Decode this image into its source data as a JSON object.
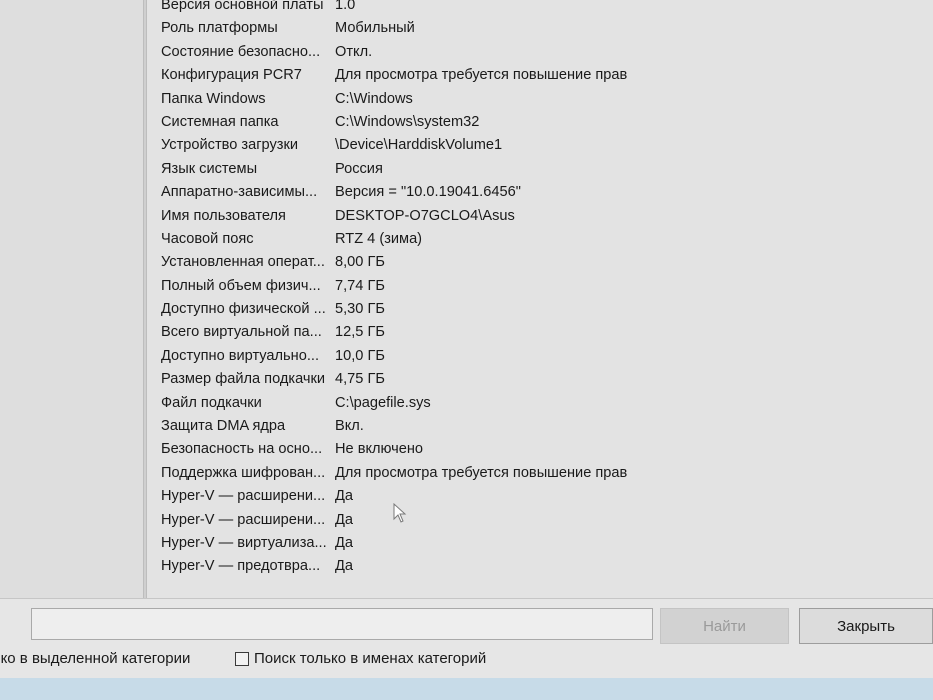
{
  "table": {
    "rows": [
      {
        "name": "Версия основной платы",
        "value": "1.0"
      },
      {
        "name": "Роль платформы",
        "value": "Мобильный"
      },
      {
        "name": "Состояние безопасно...",
        "value": "Откл."
      },
      {
        "name": "Конфигурация PCR7",
        "value": "Для просмотра требуется повышение прав"
      },
      {
        "name": "Папка Windows",
        "value": "C:\\Windows"
      },
      {
        "name": "Системная папка",
        "value": "C:\\Windows\\system32"
      },
      {
        "name": "Устройство загрузки",
        "value": "\\Device\\HarddiskVolume1"
      },
      {
        "name": "Язык системы",
        "value": "Россия"
      },
      {
        "name": "Аппаратно-зависимы...",
        "value": "Версия = \"10.0.19041.6456\""
      },
      {
        "name": "Имя пользователя",
        "value": "DESKTOP-O7GCLO4\\Asus"
      },
      {
        "name": "Часовой пояс",
        "value": "RTZ 4 (зима)"
      },
      {
        "name": "Установленная операт...",
        "value": "8,00 ГБ"
      },
      {
        "name": "Полный объем физич...",
        "value": "7,74 ГБ"
      },
      {
        "name": "Доступно физической ...",
        "value": "5,30 ГБ"
      },
      {
        "name": "Всего виртуальной па...",
        "value": "12,5 ГБ"
      },
      {
        "name": "Доступно виртуально...",
        "value": "10,0 ГБ"
      },
      {
        "name": "Размер файла подкачки",
        "value": "4,75 ГБ"
      },
      {
        "name": "Файл подкачки",
        "value": "C:\\pagefile.sys"
      },
      {
        "name": "Защита DMA ядра",
        "value": "Вкл."
      },
      {
        "name": "Безопасность на осно...",
        "value": "Не включено"
      },
      {
        "name": "Поддержка шифрован...",
        "value": "Для просмотра требуется повышение прав"
      },
      {
        "name": "Hyper-V — расширени...",
        "value": "Да"
      },
      {
        "name": "Hyper-V — расширени...",
        "value": "Да"
      },
      {
        "name": "Hyper-V — виртуализа...",
        "value": "Да"
      },
      {
        "name": "Hyper-V — предотвра...",
        "value": "Да"
      }
    ]
  },
  "search": {
    "value": "",
    "find_label": "Найти",
    "close_label": "Закрыть",
    "option_selected_category": "лько в выделенной категории",
    "option_category_names": "Поиск только в именах категорий"
  }
}
